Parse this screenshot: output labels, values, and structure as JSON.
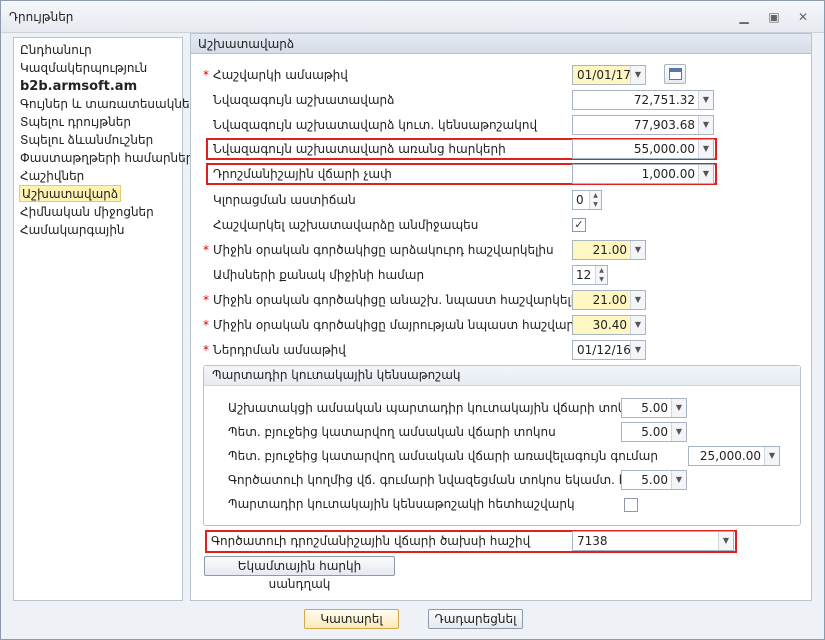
{
  "window": {
    "title": "Դրույթներ"
  },
  "nav": {
    "items": [
      {
        "label": "Ընդհանուր"
      },
      {
        "label": "Կազմակերպություն"
      },
      {
        "label": "b2b.armsoft.am"
      },
      {
        "label": "Գույներ և տառատեսակներ"
      },
      {
        "label": "Տպելու դրույթներ"
      },
      {
        "label": "Տպելու ձևանմուշներ"
      },
      {
        "label": "Փաստաթղթերի համարներ"
      },
      {
        "label": "Հաշիվներ"
      },
      {
        "label": "Աշխատավարձ"
      },
      {
        "label": "Հիմնական միջոցներ"
      },
      {
        "label": "Համակարգային"
      }
    ]
  },
  "panel": {
    "title": "Աշխատավարձ",
    "rows": {
      "calc_date": {
        "label": "Հաշվարկի ամսաթիվ",
        "value": "01/01/17"
      },
      "min_salary": {
        "label": "Նվազագույն աշխատավարձ",
        "value": "72,751.32"
      },
      "min_salary_accum": {
        "label": "Նվազագույն աշխատավարձ կուտ. կենսաթոշակով",
        "value": "77,903.68"
      },
      "min_salary_no_tax": {
        "label": "Նվազագույն աշխատավարձ առանց հարկերի",
        "value": "55,000.00"
      },
      "incentive_size": {
        "label": "Դրոշմանիշային վճարի չափ",
        "value": "1,000.00"
      },
      "rounding": {
        "label": "Կլորացման աստիճան",
        "value": "0"
      },
      "calc_immediately": {
        "label": "Հաշվարկել աշխատավարձը անմիջապես"
      },
      "avg_days_vacation": {
        "label": "Միջին օրական գործակիցը արձակուրդ հաշվարկելիս",
        "value": "21.00"
      },
      "months_for_avg": {
        "label": "Ամիսների քանակ միջինի համար",
        "value": "12"
      },
      "avg_days_disability": {
        "label": "Միջին օրական գործակիցը անաշխ. նպաստ հաշվարկելիս",
        "value": "21.00"
      },
      "avg_days_maternity": {
        "label": "Միջին օրական գործակիցը մայրության նպաստ հաշվարկելիս",
        "value": "30.40"
      },
      "implementation_date": {
        "label": "Ներդրման ամսաթիվ",
        "value": "01/12/16"
      }
    },
    "pension_group": {
      "title": "Պարտադիր կուտակային կենսաթոշակ",
      "employee_rate": {
        "label": "Աշխատակցի ամսական պարտադիր կուտակային վճարի տոկոս",
        "value": "5.00"
      },
      "state_rate": {
        "label": "Պետ. բյուջեից կատարվող ամսական վճարի տոկոս",
        "value": "5.00"
      },
      "state_max": {
        "label": "Պետ. բյուջեից կատարվող ամսական վճարի առավելագույն գումար",
        "value": "25,000.00"
      },
      "employer_rate": {
        "label": "Գործատուի կողմից վճ. գումարի նվազեցման տոկոս եկամտ. հարկից",
        "value": "5.00"
      },
      "hold_pension": {
        "label": "Պարտադիր կուտակային կենսաթոշակի հետհաշվարկ"
      }
    },
    "employer_account": {
      "label": "Գործատուի դրոշմանիշային վճարի ծախսի հաշիվ",
      "value": "7138"
    },
    "income_tax_button": "Եկամտային հարկի սանդղակ"
  },
  "footer": {
    "ok_label": "Կատարել",
    "cancel_label": "Դադարեցնել"
  },
  "colors": {
    "highlight": "#e0201f",
    "required": "#dd0000",
    "yellow_field": "#fff7c2"
  }
}
